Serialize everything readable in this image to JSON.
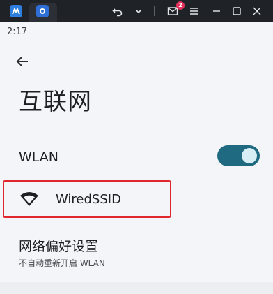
{
  "window": {
    "notification_count": "2",
    "icons": [
      "app-logo-icon",
      "settings-icon",
      "undo-icon",
      "chevron-down-icon",
      "mail-icon",
      "menu-icon",
      "minimize-icon",
      "maximize-icon",
      "close-icon"
    ]
  },
  "status_bar": {
    "time": "2:17"
  },
  "page": {
    "title": "互联网"
  },
  "wlan": {
    "label": "WLAN",
    "enabled": true
  },
  "network": {
    "name": "WiredSSID"
  },
  "preferences": {
    "title": "网络偏好设置",
    "subtitle": "不自动重新开启 WLAN"
  },
  "colors": {
    "toggle_track": "#1f6a80",
    "highlight_border": "#e0272d",
    "badge": "#e5315b"
  }
}
